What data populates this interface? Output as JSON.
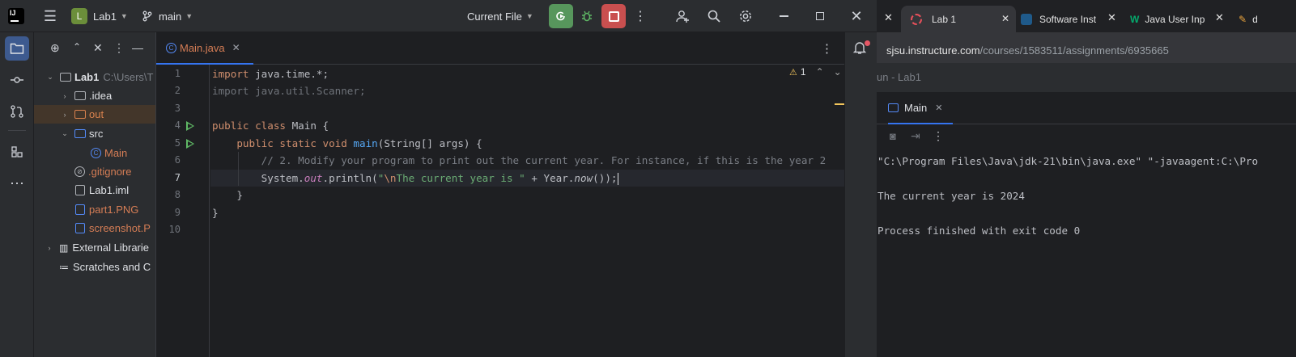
{
  "ide": {
    "project_name": "Lab1",
    "project_badge": "L",
    "branch": "main",
    "run_config": "Current File",
    "logo_text": "IJ"
  },
  "project_tree": {
    "items": [
      {
        "label": "Lab1",
        "suffix": "C:\\Users\\T"
      },
      {
        "label": ".idea"
      },
      {
        "label": "out"
      },
      {
        "label": "src"
      },
      {
        "label": "Main"
      },
      {
        "label": ".gitignore"
      },
      {
        "label": "Lab1.iml"
      },
      {
        "label": "part1.PNG"
      },
      {
        "label": "screenshot.P"
      },
      {
        "label": "External Librarie"
      },
      {
        "label": "Scratches and C"
      }
    ]
  },
  "editor": {
    "tab_label": "Main.java",
    "warning_count": "1",
    "line_numbers": [
      "1",
      "2",
      "3",
      "4",
      "5",
      "6",
      "7",
      "8",
      "9",
      "10"
    ],
    "code": {
      "l1_kw": "import",
      "l1_rest": " java.time.*;",
      "l2": "import java.util.Scanner;",
      "l4_kw": "public class",
      "l4_rest": " Main {",
      "l5_indent": "    ",
      "l5_kw": "public static void",
      "l5_fn": "main",
      "l5_rest": "(String[] args) {",
      "l6_comment": "        // 2. Modify your program to print out the current year. For instance, if this is the year 2",
      "l7_a": "        System.",
      "l7_out": "out",
      "l7_b": ".println(",
      "l7_q": "\"",
      "l7_esc": "\\n",
      "l7_str": "The current year is \"",
      "l7_c": " + Year.",
      "l7_now": "now",
      "l7_d": "());",
      "l8": "    }",
      "l9": "}"
    }
  },
  "browser": {
    "tabs": [
      {
        "label": "Lab 1"
      },
      {
        "label": "Software Inst"
      },
      {
        "label": "Java User Inp"
      },
      {
        "label": "d"
      }
    ],
    "url_host": "sjsu.instructure.com",
    "url_path": "/courses/1583511/assignments/6935665"
  },
  "run_panel": {
    "title": "un - Lab1",
    "tab_label": "Main",
    "output": [
      "\"C:\\Program Files\\Java\\jdk-21\\bin\\java.exe\" \"-javaagent:C:\\Pro",
      "The current year is 2024",
      "Process finished with exit code 0"
    ]
  }
}
